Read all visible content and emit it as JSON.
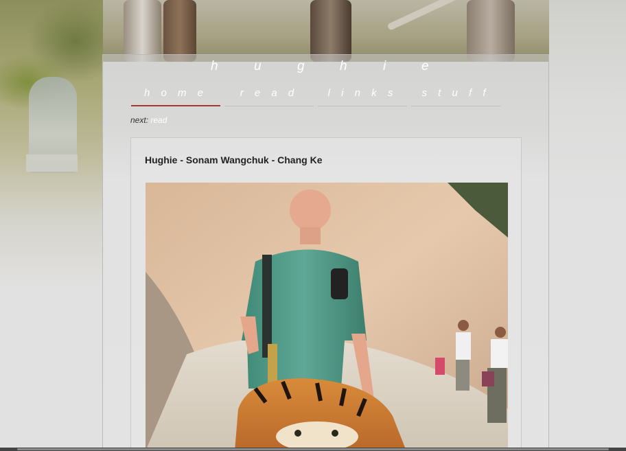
{
  "site": {
    "title_letters": [
      "h",
      "u",
      "g",
      "h",
      "i",
      "e"
    ]
  },
  "nav": {
    "items": [
      {
        "label": "h o m e",
        "active": true
      },
      {
        "label": "r e a d",
        "active": false
      },
      {
        "label": "l i n k s",
        "active": false
      },
      {
        "label": "s t u f f",
        "active": false
      }
    ]
  },
  "next": {
    "prefix": "next:",
    "link": "read"
  },
  "post": {
    "title": "Hughie - Sonam Wangchuk - Chang Ke"
  },
  "colors": {
    "active_underline": "#a33a32",
    "nav_text": "#ffffff"
  }
}
